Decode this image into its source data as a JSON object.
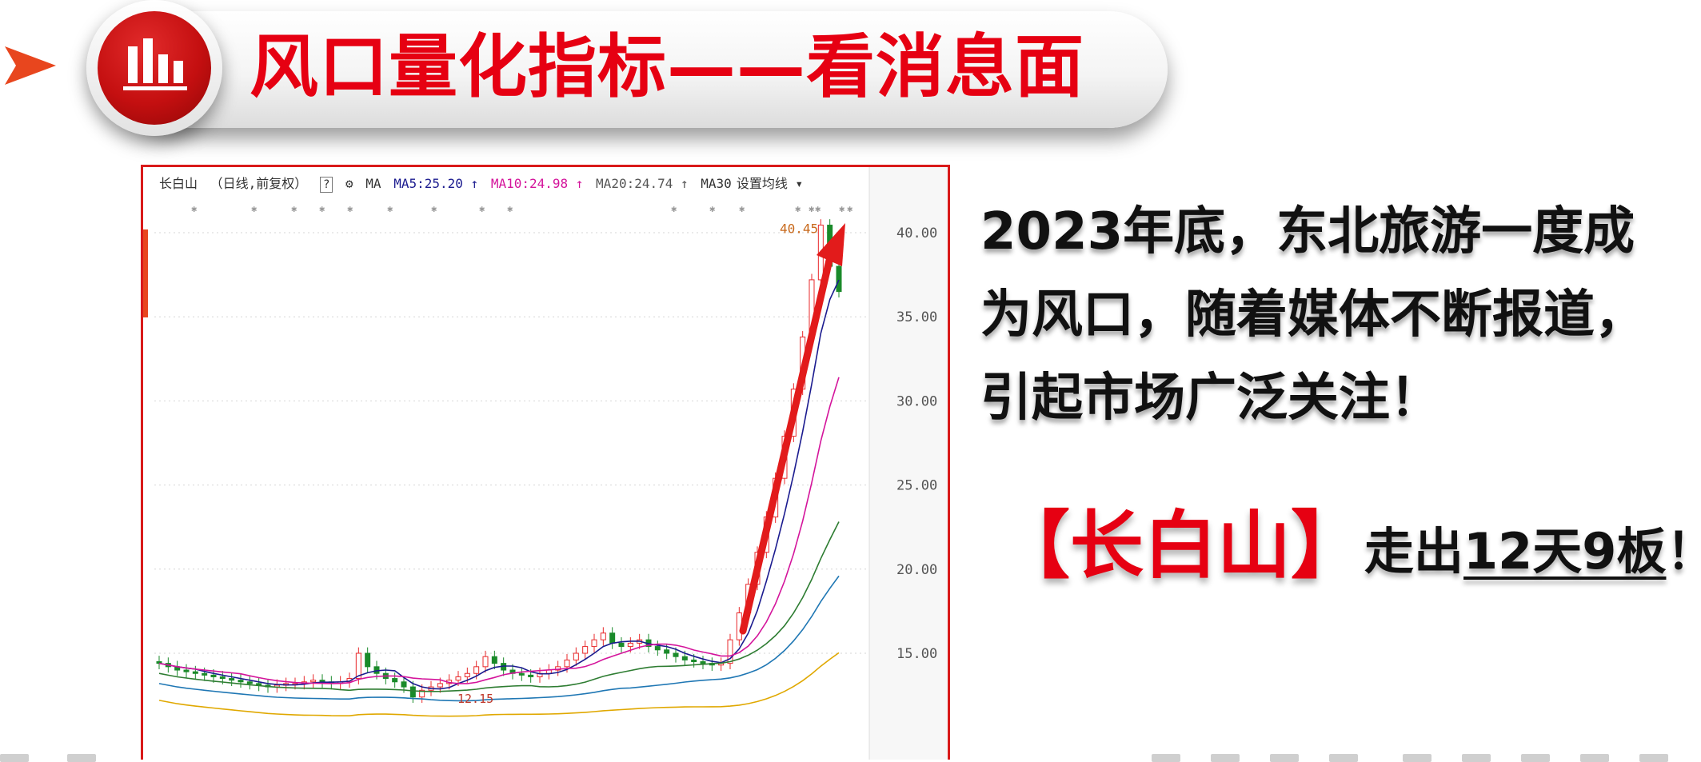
{
  "slide": {
    "title": "风口量化指标——看消息面"
  },
  "chart": {
    "stock_name": "长白山",
    "period_label": "（日线,前复权）",
    "help_label": "?",
    "settings_icon": "gear-icon",
    "ma_label": "MA",
    "ma5_label": "MA5:25.20 ↑",
    "ma10_label": "MA10:24.98 ↑",
    "ma20_label": "MA20:24.74 ↑",
    "ma30_label": "MA30",
    "set_ma_label": "设置均线 ▾",
    "peak_label": "40.45",
    "low_label": "12.15",
    "y_ticks": [
      "40.00",
      "35.00",
      "30.00",
      "25.00",
      "20.00",
      "15.00"
    ],
    "colors": {
      "up": "#e8292b",
      "down": "#1a8a2a",
      "ma5": "#1b1b8f",
      "ma10": "#d4149b",
      "ma20": "#2e7d32",
      "ma30": "#1f77b4",
      "ma60": "#e0a800",
      "arrow": "#e21b1b"
    }
  },
  "chart_data": {
    "type": "line",
    "y_ticks": [
      40,
      35,
      30,
      25,
      20,
      15
    ],
    "ylim": [
      11,
      42
    ],
    "close_series": [
      14.4,
      14.2,
      14.0,
      13.9,
      13.8,
      13.7,
      13.6,
      13.5,
      13.4,
      13.3,
      13.2,
      13.1,
      13.0,
      13.1,
      13.2,
      13.2,
      13.3,
      13.4,
      13.3,
      13.2,
      13.3,
      13.5,
      15.0,
      14.2,
      13.8,
      13.5,
      13.3,
      13.0,
      12.4,
      12.8,
      13.0,
      13.2,
      13.4,
      13.6,
      13.8,
      14.2,
      14.8,
      14.4,
      14.0,
      13.8,
      13.7,
      13.6,
      13.8,
      14.0,
      14.2,
      14.6,
      15.0,
      15.4,
      15.8,
      16.2,
      15.6,
      15.4,
      15.6,
      15.8,
      15.4,
      15.2,
      15.0,
      14.8,
      14.6,
      14.5,
      14.4,
      14.3,
      14.4,
      15.8,
      17.4,
      19.1,
      21.0,
      23.1,
      25.4,
      27.9,
      30.7,
      33.8,
      37.2,
      40.45,
      38.0,
      36.5
    ],
    "peak": 40.45,
    "low": 12.15
  },
  "text": {
    "line1": "2023年底，东北旅游一度成",
    "line2": "为风口，随着媒体不断报道，",
    "line3": "引起市场广泛关注！",
    "stock_bracket": "【长白山】",
    "result_prefix": "走出",
    "result_underlined": "12天9板",
    "result_suffix": "！"
  }
}
